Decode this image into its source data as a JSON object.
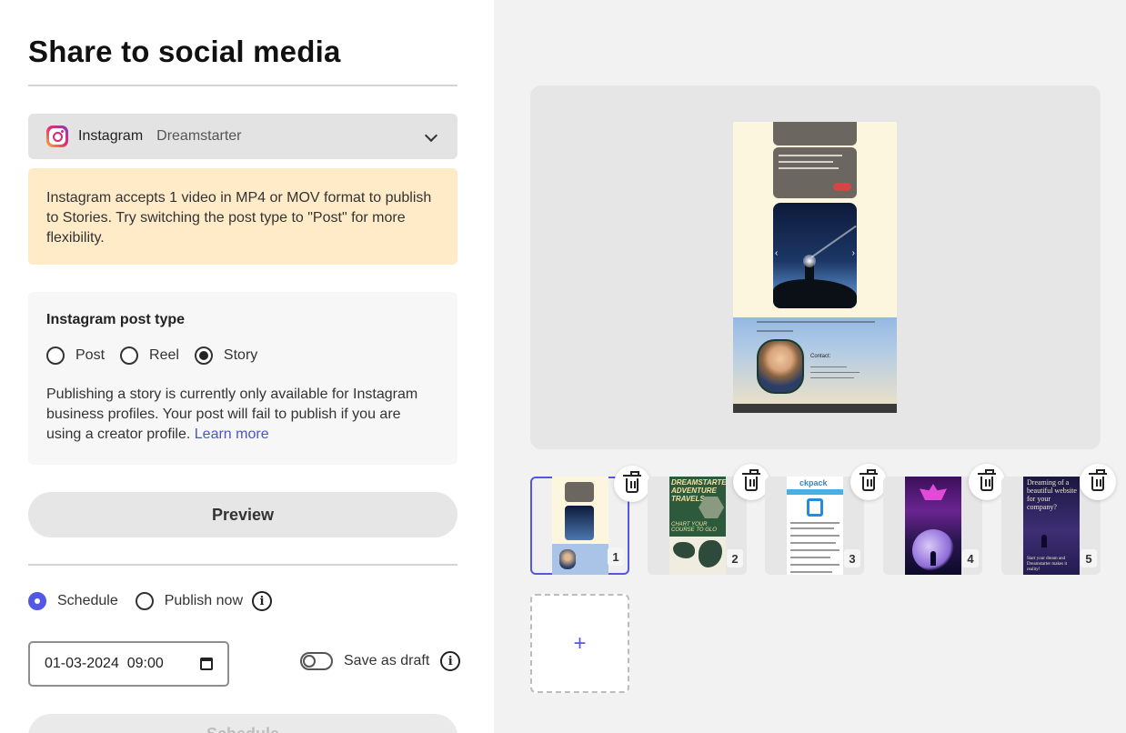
{
  "page": {
    "title": "Share to social media"
  },
  "account": {
    "platform": "Instagram",
    "name": "Dreamstarter",
    "icon": "instagram-icon",
    "dropdown_icon": "chevron-down-icon"
  },
  "notice": {
    "text": "Instagram accepts 1 video in MP4 or MOV format to publish to Stories. Try switching the post type to \"Post\" for more flexibility."
  },
  "post_type": {
    "label": "Instagram post type",
    "options": [
      "Post",
      "Reel",
      "Story"
    ],
    "selected": "Story",
    "description": "Publishing a story is currently only available for Instagram business profiles. Your post will fail to publish if you are using a creator profile.",
    "learn_more": "Learn more"
  },
  "preview_button": "Preview",
  "publish": {
    "schedule_label": "Schedule",
    "publish_now_label": "Publish now",
    "selected": "Schedule",
    "datetime_value": "01-03-2024  09:00",
    "save_draft_label": "Save as draft",
    "save_draft_on": false,
    "schedule_button": "Schedule"
  },
  "preview": {
    "contact_label": "Contact:"
  },
  "thumbnails": [
    {
      "number": "1",
      "selected": true
    },
    {
      "number": "2",
      "selected": false,
      "headline": "DREAMSTARTER ADVENTURE TRAVELS",
      "subline": "CHART YOUR COURSE TO GLO"
    },
    {
      "number": "3",
      "selected": false,
      "headline": "ckpack"
    },
    {
      "number": "4",
      "selected": false
    },
    {
      "number": "5",
      "selected": false,
      "headline": "Dreaming of a beautiful website for your company?",
      "subline": "Start your dream and Dreamstarter makes it reality!"
    }
  ],
  "add_label": "+",
  "colors": {
    "accent": "#5258e4",
    "notice_bg": "#ffebc8",
    "link": "#4a55c8"
  }
}
